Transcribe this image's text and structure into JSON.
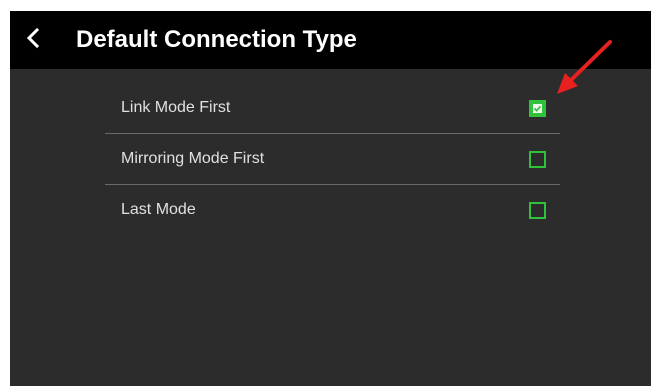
{
  "header": {
    "title": "Default Connection Type",
    "back_icon": "chevron-left-icon"
  },
  "options": [
    {
      "label": "Link Mode First",
      "checked": true
    },
    {
      "label": "Mirroring Mode First",
      "checked": false
    },
    {
      "label": "Last Mode",
      "checked": false
    }
  ],
  "colors": {
    "header_bg": "#000000",
    "screen_bg": "#2c2c2c",
    "accent_green": "#2ec33a",
    "annotation_red": "#e82020"
  }
}
